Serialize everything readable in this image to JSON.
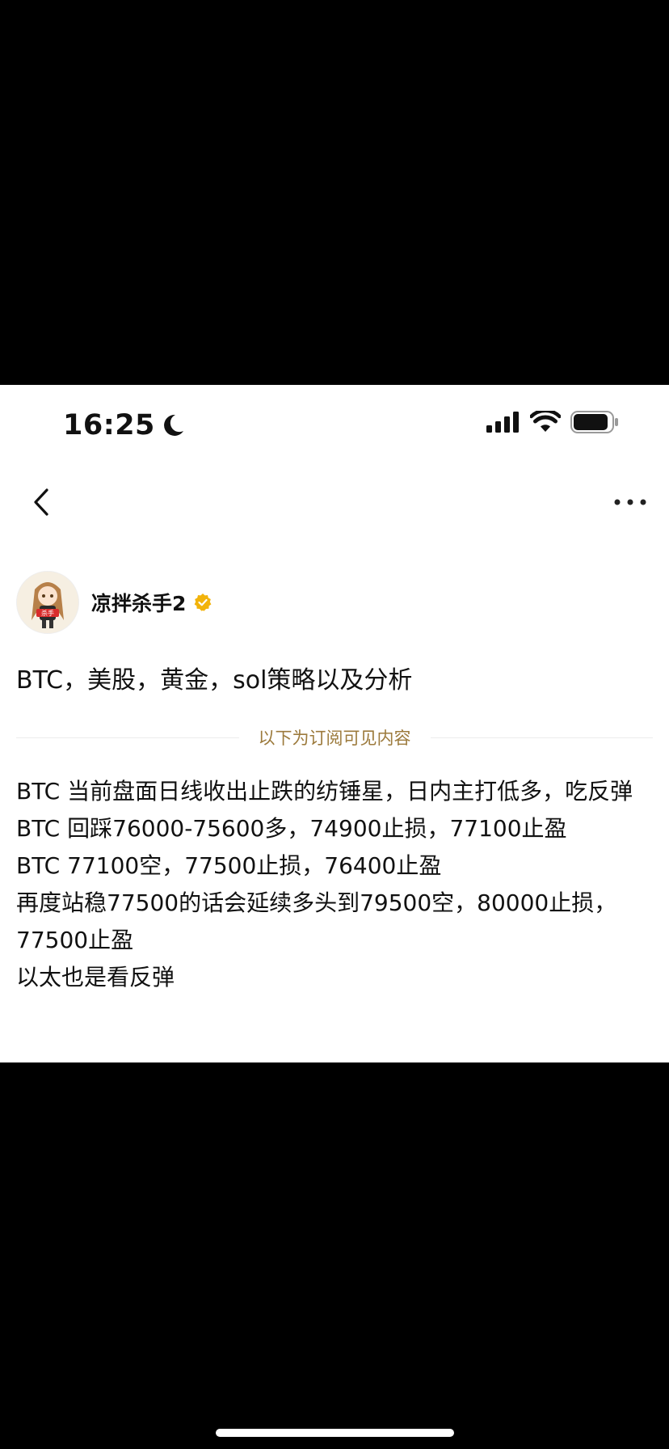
{
  "status_bar": {
    "time": "16:25",
    "focus_icon": "moon-icon",
    "signal_icon": "cellular-signal-icon",
    "wifi_icon": "wifi-icon",
    "battery_icon": "battery-icon"
  },
  "nav": {
    "back_icon": "chevron-left-icon",
    "more_icon": "more-dots-icon"
  },
  "author": {
    "name": "凉拌杀手2",
    "badge_icon": "verified-badge-icon",
    "avatar_icon": "avatar-image",
    "avatar_text": "杀手"
  },
  "post": {
    "title": "BTC，美股，黄金，sol策略以及分析",
    "subscription_divider": "以下为订阅可见内容",
    "paragraphs": [
      "BTC 当前盘面日线收出止跌的纺锤星，日内主打低多，吃反弹",
      "BTC 回踩76000-75600多，74900止损，77100止盈",
      "BTC 77100空，77500止损，76400止盈",
      "再度站稳77500的话会延续多头到79500空，80000止损，77500止盈",
      "以太也是看反弹"
    ]
  },
  "colors": {
    "accent_gold": "#9c7a3c",
    "badge_gold": "#f2b30a",
    "text": "#111111",
    "background": "#ffffff"
  }
}
